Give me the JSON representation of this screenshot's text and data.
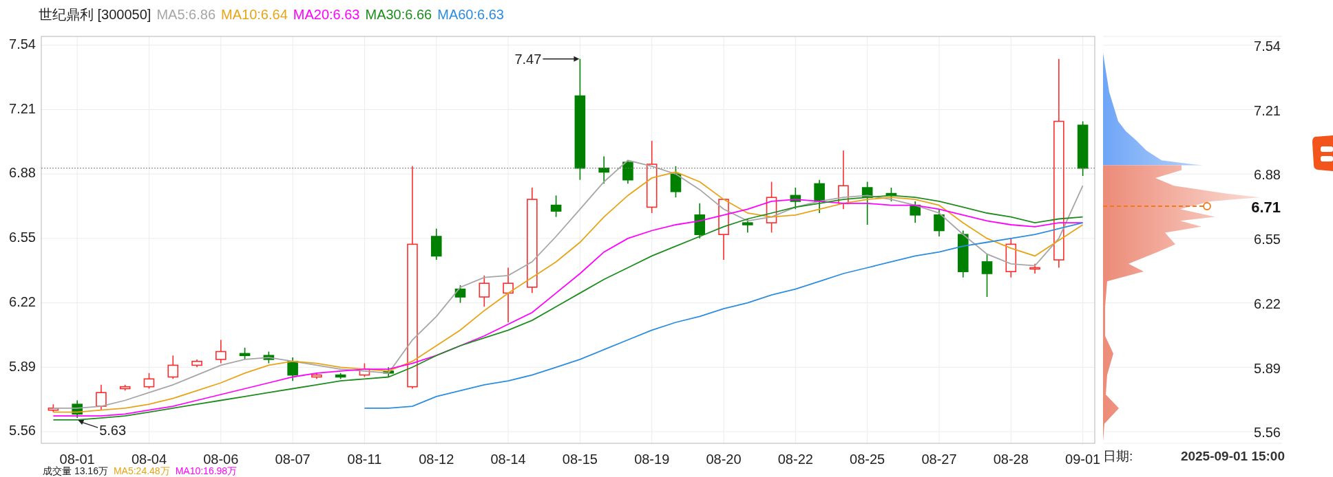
{
  "header": {
    "title": "世纪鼎利 [300050]",
    "indicators": [
      {
        "label": "MA5:6.86",
        "color": "#a6a6a6"
      },
      {
        "label": "MA10:6.64",
        "color": "#e8a317"
      },
      {
        "label": "MA20:6.63",
        "color": "#ff00ff"
      },
      {
        "label": "MA30:6.66",
        "color": "#1e8c1e"
      },
      {
        "label": "MA60:6.63",
        "color": "#2b8ce0"
      }
    ]
  },
  "chart": {
    "axis_labels": [
      "7.54",
      "7.21",
      "6.88",
      "6.55",
      "6.22",
      "5.89",
      "5.56"
    ],
    "chart_data": {
      "type": "candlestick",
      "ylim": [
        5.5,
        7.585
      ],
      "categories": [
        null,
        "08-01",
        null,
        null,
        "08-04",
        null,
        null,
        "08-06",
        null,
        null,
        "08-07",
        null,
        null,
        "08-11",
        null,
        null,
        "08-12",
        null,
        null,
        "08-14",
        null,
        null,
        "08-15",
        null,
        null,
        "08-19",
        null,
        null,
        "08-20",
        null,
        null,
        "08-22",
        null,
        null,
        "08-25",
        null,
        null,
        "08-27",
        null,
        null,
        "08-28",
        null,
        null,
        "09-01"
      ],
      "yticks": [
        7.54,
        7.21,
        6.88,
        6.55,
        6.22,
        5.89,
        5.56
      ],
      "ohlc": [
        [
          5.67,
          5.7,
          5.66,
          5.68
        ],
        [
          5.7,
          5.72,
          5.63,
          5.65
        ],
        [
          5.69,
          5.8,
          5.67,
          5.76
        ],
        [
          5.78,
          5.8,
          5.77,
          5.79
        ],
        [
          5.79,
          5.86,
          5.78,
          5.83
        ],
        [
          5.84,
          5.95,
          5.83,
          5.9
        ],
        [
          5.9,
          5.93,
          5.89,
          5.92
        ],
        [
          5.93,
          6.03,
          5.91,
          5.97
        ],
        [
          5.96,
          5.99,
          5.93,
          5.95
        ],
        [
          5.95,
          5.97,
          5.91,
          5.93
        ],
        [
          5.92,
          5.94,
          5.82,
          5.85
        ],
        [
          5.84,
          5.86,
          5.83,
          5.85
        ],
        [
          5.85,
          5.86,
          5.83,
          5.84
        ],
        [
          5.85,
          5.91,
          5.84,
          5.88
        ],
        [
          5.87,
          5.89,
          5.84,
          5.86
        ],
        [
          5.79,
          6.92,
          5.78,
          6.52
        ],
        [
          6.56,
          6.6,
          6.44,
          6.46
        ],
        [
          6.29,
          6.31,
          6.22,
          6.25
        ],
        [
          6.25,
          6.36,
          6.2,
          6.32
        ],
        [
          6.27,
          6.4,
          6.12,
          6.32
        ],
        [
          6.3,
          6.81,
          6.27,
          6.75
        ],
        [
          6.72,
          6.77,
          6.66,
          6.69
        ],
        [
          7.28,
          7.47,
          6.85,
          6.91
        ],
        [
          6.91,
          6.97,
          6.83,
          6.89
        ],
        [
          6.94,
          6.95,
          6.83,
          6.85
        ],
        [
          6.71,
          7.05,
          6.68,
          6.93
        ],
        [
          6.88,
          6.92,
          6.76,
          6.79
        ],
        [
          6.67,
          6.73,
          6.55,
          6.57
        ],
        [
          6.57,
          6.75,
          6.44,
          6.75
        ],
        [
          6.63,
          6.65,
          6.58,
          6.62
        ],
        [
          6.63,
          6.84,
          6.58,
          6.76
        ],
        [
          6.77,
          6.81,
          6.7,
          6.74
        ],
        [
          6.83,
          6.85,
          6.68,
          6.74
        ],
        [
          6.73,
          7.0,
          6.7,
          6.82
        ],
        [
          6.81,
          6.84,
          6.62,
          6.76
        ],
        [
          6.78,
          6.81,
          6.74,
          6.77
        ],
        [
          6.72,
          6.74,
          6.63,
          6.67
        ],
        [
          6.67,
          6.7,
          6.56,
          6.59
        ],
        [
          6.57,
          6.59,
          6.35,
          6.38
        ],
        [
          6.43,
          6.47,
          6.25,
          6.37
        ],
        [
          6.38,
          6.55,
          6.35,
          6.52
        ],
        [
          6.4,
          6.42,
          6.37,
          6.4
        ],
        [
          6.44,
          7.47,
          6.4,
          7.15
        ],
        [
          7.13,
          7.15,
          6.87,
          6.91
        ]
      ],
      "grid": true,
      "ref_lines": [
        {
          "axis": "y",
          "value": 6.91
        }
      ],
      "series": [
        {
          "type": "line",
          "color": "#a6a6a6",
          "values": [
            5.68,
            5.68,
            5.69,
            5.72,
            5.76,
            5.8,
            5.85,
            5.9,
            5.93,
            5.94,
            5.92,
            5.9,
            5.88,
            5.87,
            5.86,
            6.03,
            6.15,
            6.3,
            6.35,
            6.36,
            6.43,
            6.56,
            6.7,
            6.84,
            6.95,
            6.92,
            6.88,
            6.8,
            6.7,
            6.64,
            6.66,
            6.71,
            6.74,
            6.76,
            6.77,
            6.75,
            6.72,
            6.68,
            6.57,
            6.47,
            6.42,
            6.41,
            6.55,
            6.82
          ]
        },
        {
          "type": "line",
          "color": "#e8a317",
          "values": [
            5.66,
            5.66,
            5.67,
            5.68,
            5.7,
            5.73,
            5.77,
            5.81,
            5.86,
            5.9,
            5.92,
            5.91,
            5.89,
            5.88,
            5.87,
            5.92,
            6.0,
            6.08,
            6.18,
            6.27,
            6.35,
            6.43,
            6.53,
            6.66,
            6.77,
            6.86,
            6.89,
            6.84,
            6.75,
            6.68,
            6.66,
            6.67,
            6.7,
            6.73,
            6.75,
            6.76,
            6.75,
            6.72,
            6.63,
            6.55,
            6.5,
            6.46,
            6.54,
            6.62
          ]
        },
        {
          "type": "line",
          "color": "#ff00ff",
          "values": [
            5.64,
            5.64,
            5.64,
            5.65,
            5.67,
            5.69,
            5.72,
            5.75,
            5.78,
            5.81,
            5.84,
            5.86,
            5.87,
            5.88,
            5.88,
            5.91,
            5.95,
            6.0,
            6.05,
            6.11,
            6.17,
            6.27,
            6.37,
            6.48,
            6.55,
            6.59,
            6.62,
            6.64,
            6.67,
            6.7,
            6.74,
            6.75,
            6.74,
            6.73,
            6.73,
            6.72,
            6.72,
            6.7,
            6.67,
            6.64,
            6.62,
            6.61,
            6.63,
            6.63
          ]
        },
        {
          "type": "line",
          "color": "#1e8c1e",
          "values": [
            5.62,
            5.62,
            5.63,
            5.64,
            5.66,
            5.68,
            5.7,
            5.72,
            5.74,
            5.76,
            5.78,
            5.8,
            5.82,
            5.83,
            5.84,
            5.89,
            5.95,
            6.0,
            6.04,
            6.08,
            6.13,
            6.2,
            6.27,
            6.34,
            6.4,
            6.46,
            6.51,
            6.56,
            6.61,
            6.65,
            6.68,
            6.71,
            6.73,
            6.75,
            6.76,
            6.77,
            6.76,
            6.74,
            6.71,
            6.68,
            6.66,
            6.63,
            6.65,
            6.66
          ]
        },
        {
          "type": "line",
          "color": "#2b8ce0",
          "values": [
            null,
            null,
            null,
            null,
            null,
            null,
            null,
            null,
            null,
            null,
            null,
            null,
            null,
            5.68,
            5.68,
            5.69,
            5.74,
            5.77,
            5.8,
            5.82,
            5.85,
            5.89,
            5.93,
            5.98,
            6.03,
            6.08,
            6.12,
            6.15,
            6.19,
            6.22,
            6.26,
            6.29,
            6.33,
            6.37,
            6.4,
            6.43,
            6.46,
            6.48,
            6.51,
            6.53,
            6.55,
            6.57,
            6.6,
            6.63
          ]
        }
      ],
      "annotations": [
        {
          "text": "7.47",
          "x": "08-15",
          "y": 7.47
        },
        {
          "text": "5.63",
          "x": "08-01",
          "y": 5.63
        }
      ]
    }
  },
  "profile": {
    "axis_labels": [
      "7.54",
      "7.21",
      "6.88",
      "6.55",
      "6.22",
      "5.89",
      "5.56"
    ],
    "price_label": "6.71",
    "date_label": "日期:",
    "date_value": "2025-09-01 15:00"
  },
  "volume": {
    "label": "成交量 13.16万",
    "indicators": [
      {
        "label": "MA5:24.48万",
        "color": "#e8a317"
      },
      {
        "label": "MA10:16.98万",
        "color": "#ff00ff"
      }
    ]
  }
}
